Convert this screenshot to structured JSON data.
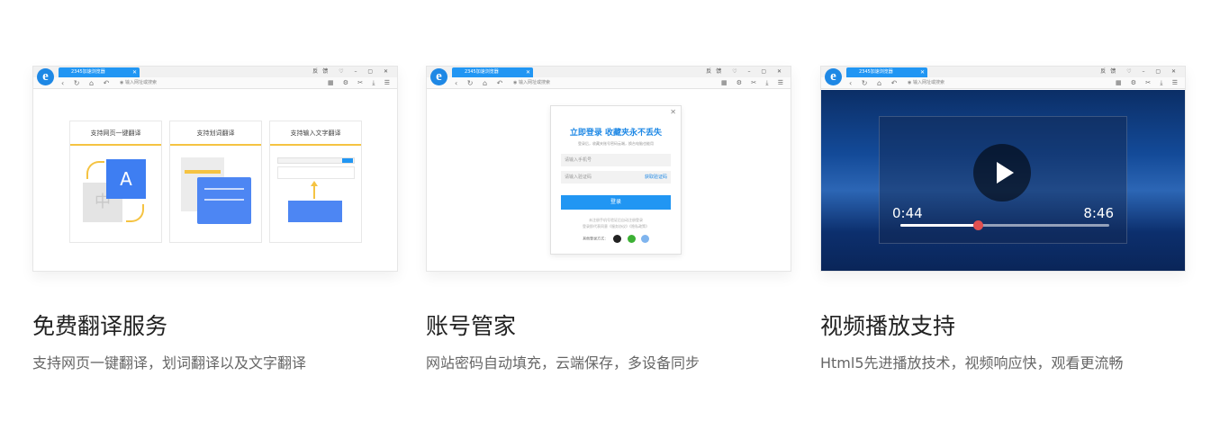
{
  "features": [
    {
      "title": "免费翻译服务",
      "desc": "支持网页一键翻译，划词翻译以及文字翻译",
      "browser": {
        "tab_label": "2345加速浏览器",
        "url_placeholder": "输入网址或搜索",
        "win_controls": "反馈 ♡ – ▢ ✕"
      },
      "cards": [
        "支持网页一键翻译",
        "支持划词翻译",
        "支持输入文字翻译"
      ],
      "card_glyphs": {
        "big": "A",
        "small": "中"
      }
    },
    {
      "title": "账号管家",
      "desc": "网站密码自动填充，云端保存，多设备同步",
      "browser": {
        "tab_label": "2345加速浏览器",
        "url_placeholder": "输入网址或搜索",
        "win_controls": "反馈 ♡ – ▢ ✕"
      },
      "login": {
        "title": "立即登录 收藏夹永不丢失",
        "subtitle": "登录后，收藏夹账号密码云端，换台电脑也能用",
        "phone_placeholder": "请输入手机号",
        "code_placeholder": "请输入验证码",
        "get_code": "获取验证码",
        "submit": "登录",
        "note_line1": "未注册手机号验证后自动注册登录",
        "note_line2": "登录即代表同意《服务协议》《隐私政策》",
        "other_login": "其他登录方式："
      }
    },
    {
      "title": "视频播放支持",
      "desc": "Html5先进播放技术，视频响应快，观看更流畅",
      "browser": {
        "tab_label": "2345加速浏览器",
        "url_placeholder": "输入网址或搜索",
        "win_controls": "反馈 ♡ – ▢ ✕"
      },
      "video": {
        "current_time": "0:44",
        "duration": "8:46",
        "progress": 0.37
      }
    }
  ],
  "icons": {
    "nav": "‹ ↻ ⌂ ↶",
    "tools": "▦ ⚙ ✂ ⤓ ☰"
  },
  "colors": {
    "accent": "#2196f3",
    "card_underline": "#f5c342",
    "progress_knob": "#e05050"
  }
}
